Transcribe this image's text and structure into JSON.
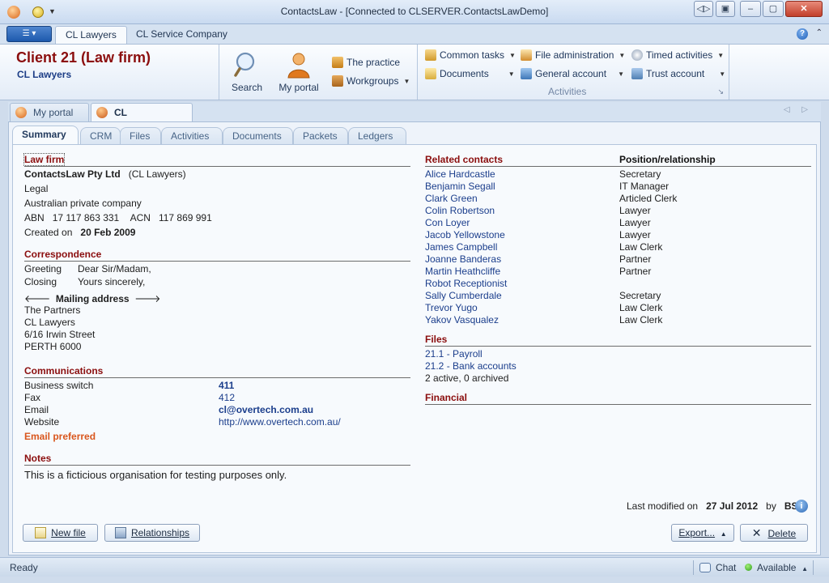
{
  "window": {
    "title": "ContactsLaw - [Connected to CLSERVER.ContactsLawDemo]",
    "controls": [
      "◁▷",
      "▣",
      "–",
      "▢",
      "✕"
    ]
  },
  "ribbon_tabs": {
    "app_button": "☰ ▾",
    "tabs": [
      "CL Lawyers",
      "CL Service Company"
    ],
    "help": "?",
    "chevron": "⌃"
  },
  "header": {
    "client_title": "Client 21 (Law firm)",
    "client_subtitle": "CL Lawyers"
  },
  "ribbon": {
    "search_label": "Search",
    "portal_label": "My portal",
    "practice_label": "The practice",
    "workgroups_label": "Workgroups",
    "common_tasks_label": "Common tasks",
    "documents_label": "Documents",
    "file_admin_label": "File administration",
    "general_account_label": "General account",
    "timed_activities_label": "Timed activities",
    "trust_account_label": "Trust account",
    "activities_group_label": "Activities"
  },
  "doc_tabs": {
    "tabs": [
      "My portal",
      "CL Lawyers"
    ],
    "close": "✕",
    "nav": "◁ ▷"
  },
  "sub_tabs": [
    "Summary",
    "CRM",
    "Files",
    "Activities",
    "Documents",
    "Packets",
    "Ledgers"
  ],
  "law_firm": {
    "heading": "Law firm",
    "name": "ContactsLaw Pty Ltd",
    "alias": "(CL Lawyers)",
    "type": "Legal",
    "entity": "Australian private company",
    "abn_label": "ABN",
    "abn": "17 117 863 331",
    "acn_label": "ACN",
    "acn": "117 869 991",
    "created_label": "Created on",
    "created": "20 Feb 2009"
  },
  "correspondence": {
    "heading": "Correspondence",
    "greeting_label": "Greeting",
    "greeting": "Dear Sir/Madam,",
    "closing_label": "Closing",
    "closing": "Yours sincerely,",
    "mailing_label": "Mailing address",
    "address_lines": [
      "The Partners",
      "CL Lawyers",
      "6/16 Irwin Street",
      "PERTH 6000"
    ]
  },
  "communications": {
    "heading": "Communications",
    "rows": [
      {
        "label": "Business switch",
        "value": "411"
      },
      {
        "label": "Fax",
        "value": "412"
      },
      {
        "label": "Email",
        "value": "cl@overtech.com.au"
      },
      {
        "label": "Website",
        "value": "http://www.overtech.com.au/"
      }
    ],
    "email_preferred": "Email preferred"
  },
  "notes": {
    "heading": "Notes",
    "text": "This is a ficticious organisation for testing purposes only."
  },
  "related_contacts": {
    "heading": "Related contacts",
    "position_heading": "Position/relationship",
    "rows": [
      {
        "name": "Alice Hardcastle",
        "position": "Secretary"
      },
      {
        "name": "Benjamin Segall",
        "position": "IT Manager"
      },
      {
        "name": "Clark Green",
        "position": "Articled Clerk"
      },
      {
        "name": "Colin Robertson",
        "position": "Lawyer"
      },
      {
        "name": "Con Loyer",
        "position": "Lawyer"
      },
      {
        "name": "Jacob Yellowstone",
        "position": "Lawyer"
      },
      {
        "name": "James Campbell",
        "position": "Law Clerk"
      },
      {
        "name": "Joanne Banderas",
        "position": "Partner"
      },
      {
        "name": "Martin Heathcliffe",
        "position": "Partner"
      },
      {
        "name": "Robot Receptionist",
        "position": ""
      },
      {
        "name": "Sally Cumberdale",
        "position": "Secretary"
      },
      {
        "name": "Trevor Yugo",
        "position": "Law Clerk"
      },
      {
        "name": "Yakov Vasqualez",
        "position": "Law Clerk"
      }
    ]
  },
  "files": {
    "heading": "Files",
    "items": [
      "21.1 - Payroll",
      "21.2 - Bank accounts"
    ],
    "summary": "2 active, 0 archived"
  },
  "financial": {
    "heading": "Financial"
  },
  "modified": {
    "label": "Last modified on",
    "date": "27 Jul 2012",
    "by_label": "by",
    "user": "BS"
  },
  "buttons": {
    "new_file": "New file",
    "relationships": "Relationships",
    "export": "Export...",
    "delete": "Delete"
  },
  "status": {
    "text": "Ready",
    "chat": "Chat",
    "availability": "Available"
  },
  "colors": {
    "accent_red": "#8b0e0e",
    "link_blue": "#1b3e8c",
    "email_preferred": "#d9561d",
    "available_green": "#2b9b15"
  }
}
